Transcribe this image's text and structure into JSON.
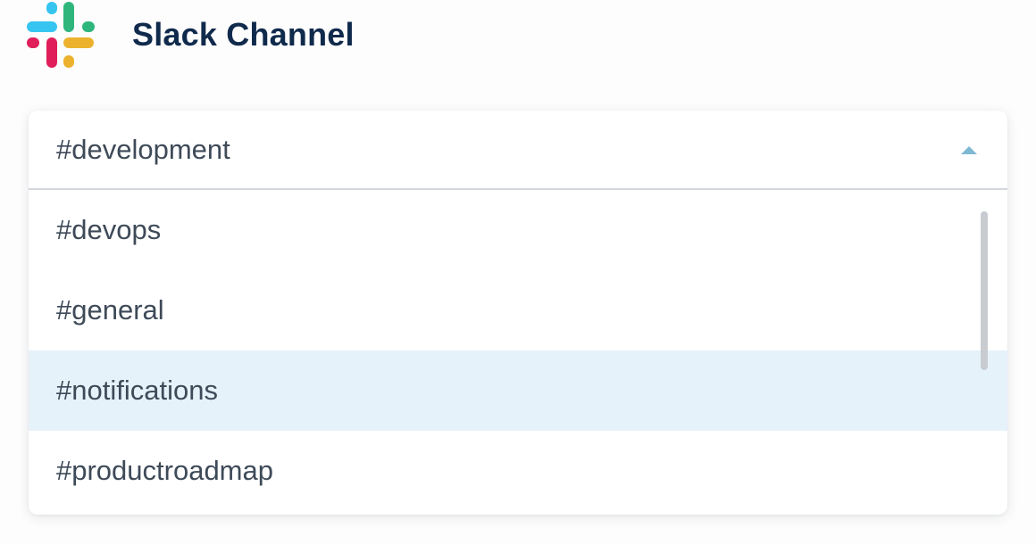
{
  "header": {
    "logo_icon": "slack-logo-icon",
    "title": "Slack Channel"
  },
  "select": {
    "value": "#development",
    "caret_icon": "caret-up-icon",
    "expanded": true
  },
  "options": [
    {
      "label": "#devops",
      "highlighted": false
    },
    {
      "label": "#general",
      "highlighted": false
    },
    {
      "label": "#notifications",
      "highlighted": true
    },
    {
      "label": "#productroadmap",
      "highlighted": false
    }
  ],
  "colors": {
    "title": "#102a4c",
    "text": "#3e4a58",
    "highlight": "#e6f2fa",
    "caret": "#7fb8d3",
    "slack_blue": "#36c5f0",
    "slack_green": "#2eb67d",
    "slack_yellow": "#ecb22e",
    "slack_red": "#e01e5a"
  }
}
